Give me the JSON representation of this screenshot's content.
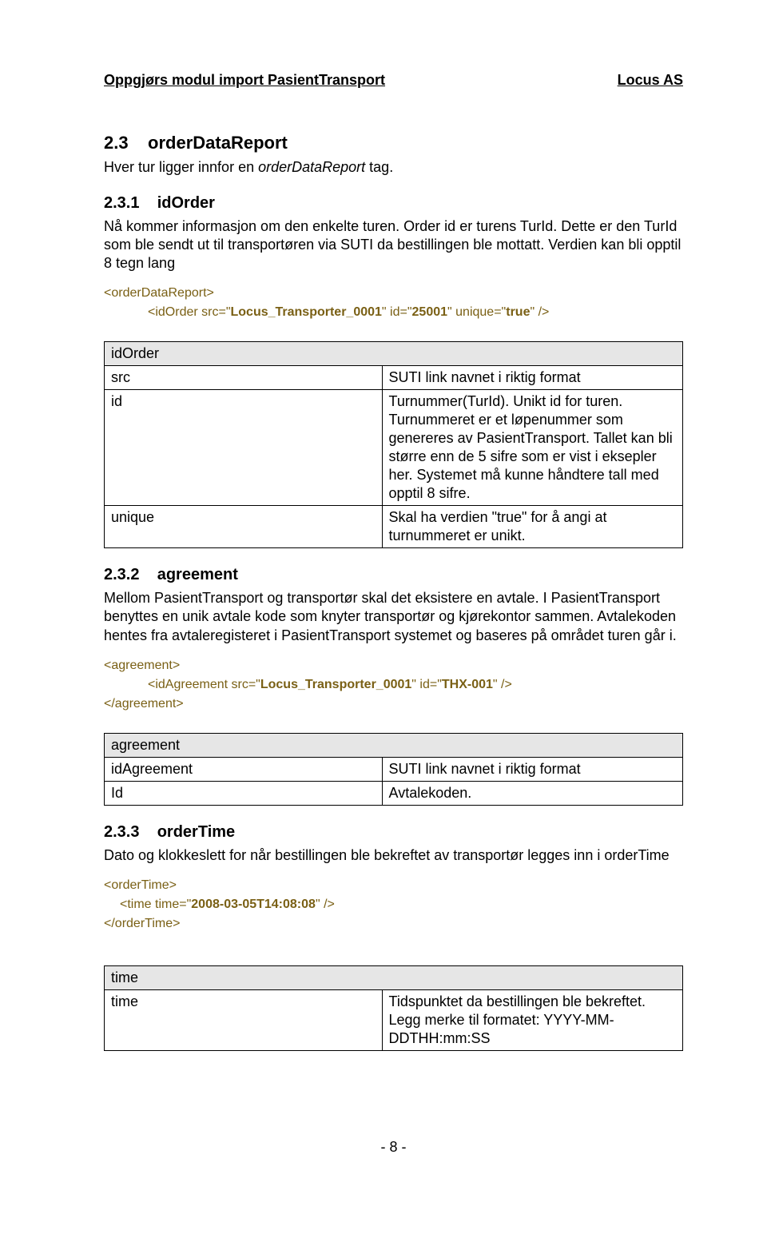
{
  "header": {
    "left": "Oppgjørs modul import PasientTransport",
    "right": "Locus AS"
  },
  "sec23": {
    "num": "2.3",
    "title": "orderDataReport",
    "p1a": "Hver tur ligger innfor en ",
    "p1i": "orderDataReport",
    "p1b": " tag."
  },
  "sec231": {
    "num": "2.3.1",
    "title": "idOrder",
    "p1": "Nå kommer informasjon om den enkelte turen. Order id er turens TurId. Dette er den TurId som ble sendt ut til transportøren via SUTI da bestillingen ble mottatt. Verdien kan bli opptil 8 tegn lang",
    "code": {
      "l1": "<orderDataReport>",
      "l2a": "<idOrder src=\"",
      "l2b": "Locus_Transporter_0001",
      "l2c": "\" id=\"",
      "l2d": "25001",
      "l2e": "\" unique=\"",
      "l2f": "true",
      "l2g": "\" />"
    },
    "table": {
      "header": "idOrder",
      "rows": [
        {
          "k": "src",
          "v": "SUTI link navnet i riktig format"
        },
        {
          "k": "id",
          "v": "Turnummer(TurId). Unikt id for  turen. Turnummeret er et løpenummer som genereres av PasientTransport. Tallet kan bli større enn de 5 sifre som er vist i eksepler her. Systemet må kunne håndtere tall med opptil 8 sifre."
        },
        {
          "k": "unique",
          "v": "Skal ha verdien \"true\" for å angi at turnummeret er unikt."
        }
      ]
    }
  },
  "sec232": {
    "num": "2.3.2",
    "title": "agreement",
    "p1": "Mellom PasientTransport og transportør skal det eksistere en avtale. I PasientTransport benyttes en unik avtale kode som knyter transportør og kjørekontor sammen. Avtalekoden hentes fra avtaleregisteret i PasientTransport systemet og baseres på området turen går i.",
    "code": {
      "l1": "<agreement>",
      "l2a": "<idAgreement src=\"",
      "l2b": "Locus_Transporter_0001",
      "l2c": "\" id=\"",
      "l2d": "THX-001",
      "l2e": "\" />",
      "l3": "</agreement>"
    },
    "table": {
      "header": "agreement",
      "rows": [
        {
          "k": "idAgreement",
          "v": "SUTI link navnet i riktig format"
        },
        {
          "k": "Id",
          "v": "Avtalekoden."
        }
      ]
    }
  },
  "sec233": {
    "num": "2.3.3",
    "title": "orderTime",
    "p1": "Dato og klokkeslett for når bestillingen ble bekreftet av transportør legges inn i orderTime",
    "code": {
      "l1": "<orderTime>",
      "l2a": "<time time=\"",
      "l2b": "2008-03-05T14:08:08",
      "l2c": "\" />",
      "l3": "</orderTime>"
    },
    "table": {
      "header": "time",
      "rows": [
        {
          "k": "time",
          "v": "Tidspunktet da bestillingen ble bekreftet. Legg merke til formatet: YYYY-MM-DDTHH:mm:SS"
        }
      ]
    }
  },
  "footer": "- 8 -"
}
